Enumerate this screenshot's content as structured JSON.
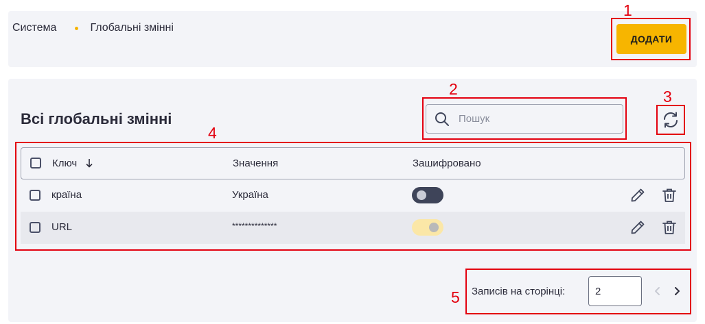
{
  "header": {
    "breadcrumb": [
      "Система",
      "Глобальні змінні"
    ],
    "add_label": "ДОДАТИ"
  },
  "section": {
    "title": "Всі глобальні змінні"
  },
  "search": {
    "placeholder": "Пошук",
    "value": ""
  },
  "table": {
    "columns": [
      "Ключ",
      "Значення",
      "Зашифровано"
    ],
    "sort_column": "Ключ",
    "sort_direction": "descending",
    "rows": [
      {
        "key": "країна",
        "value": "Україна",
        "encrypted": false
      },
      {
        "key": "URL",
        "value": "**************",
        "encrypted": true
      }
    ]
  },
  "pagination": {
    "rows_per_page_label": "Записів на сторінці:",
    "rows_per_page": "2"
  },
  "annotations": [
    "1",
    "2",
    "3",
    "4",
    "5"
  ],
  "colors": {
    "accent": "#f7b500",
    "annotation": "#e3000f",
    "toggle_off": "#3e4459",
    "toggle_on": "#fbe7a7"
  }
}
